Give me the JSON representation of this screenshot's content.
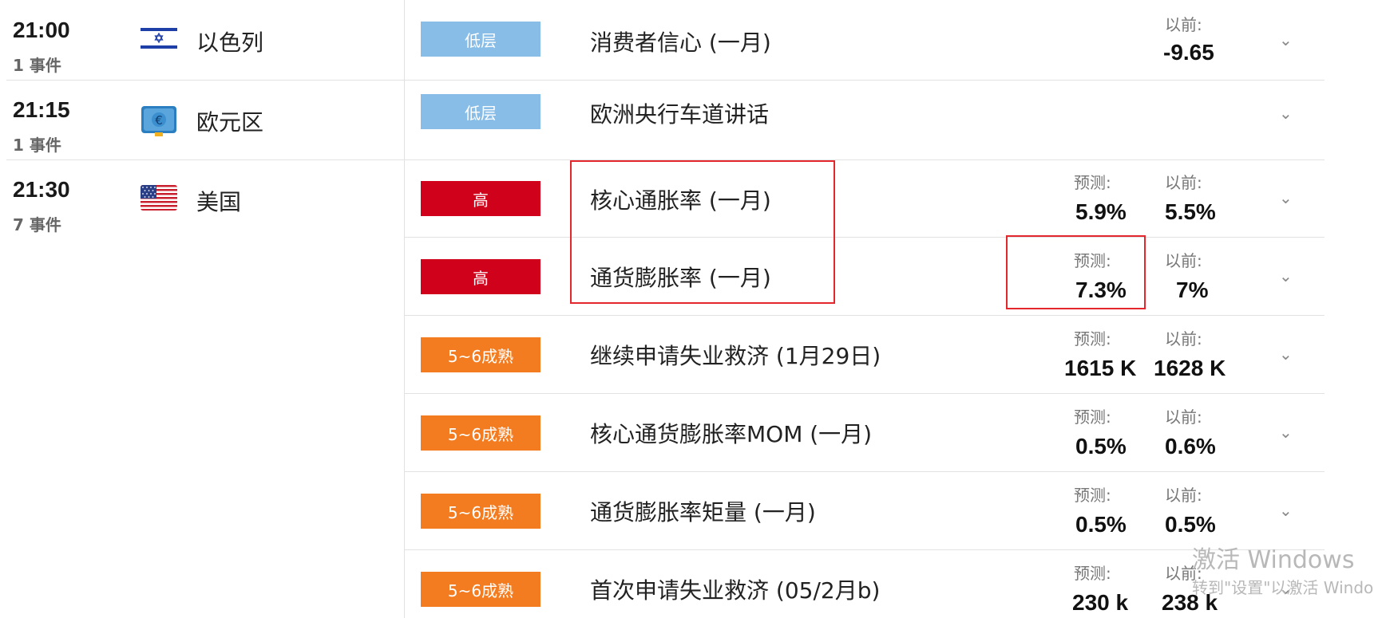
{
  "groups": [
    {
      "time": "21:00",
      "count": "1 事件",
      "country": "以色列",
      "flag": "israel-flag"
    },
    {
      "time": "21:15",
      "count": "1 事件",
      "country": "欧元区",
      "flag": "eurozone-flag"
    },
    {
      "time": "21:30",
      "count": "7 事件",
      "country": "美国",
      "flag": "usa-flag"
    }
  ],
  "events": [
    {
      "impact": "低层",
      "impact_color": "#88bde8",
      "name": "消费者信心 (一月)",
      "forecast_label": "",
      "forecast": "",
      "previous_label": "以前:",
      "previous": "-9.65"
    },
    {
      "impact": "低层",
      "impact_color": "#88bde8",
      "name": "欧洲央行车道讲话",
      "forecast_label": "",
      "forecast": "",
      "previous_label": "",
      "previous": ""
    },
    {
      "impact": "高",
      "impact_color": "#d0021b",
      "name": "核心通胀率 (一月)",
      "forecast_label": "预测:",
      "forecast": "5.9%",
      "previous_label": "以前:",
      "previous": "5.5%"
    },
    {
      "impact": "高",
      "impact_color": "#d0021b",
      "name": "通货膨胀率 (一月)",
      "forecast_label": "预测:",
      "forecast": "7.3%",
      "previous_label": "以前:",
      "previous": "7%"
    },
    {
      "impact": "5~6成熟",
      "impact_color": "#f47c20",
      "name": "继续申请失业救济 (1月29日)",
      "forecast_label": "预测:",
      "forecast": "1615 K",
      "previous_label": "以前:",
      "previous": "1628 K"
    },
    {
      "impact": "5~6成熟",
      "impact_color": "#f47c20",
      "name": "核心通货膨胀率MOM (一月)",
      "forecast_label": "预测:",
      "forecast": "0.5%",
      "previous_label": "以前:",
      "previous": "0.6%"
    },
    {
      "impact": "5~6成熟",
      "impact_color": "#f47c20",
      "name": "通货膨胀率矩量 (一月)",
      "forecast_label": "预测:",
      "forecast": "0.5%",
      "previous_label": "以前:",
      "previous": "0.5%"
    },
    {
      "impact": "5~6成熟",
      "impact_color": "#f47c20",
      "name": "首次申请失业救济 (05/2月b)",
      "forecast_label": "预测:",
      "forecast": "230 k",
      "previous_label": "以前:",
      "previous": "238 k"
    }
  ],
  "watermark": {
    "line1": "激活 Windows",
    "line2": "转到\"设置\"以激活 Windo"
  },
  "icons": {
    "expand": "chevron-down-icon"
  }
}
